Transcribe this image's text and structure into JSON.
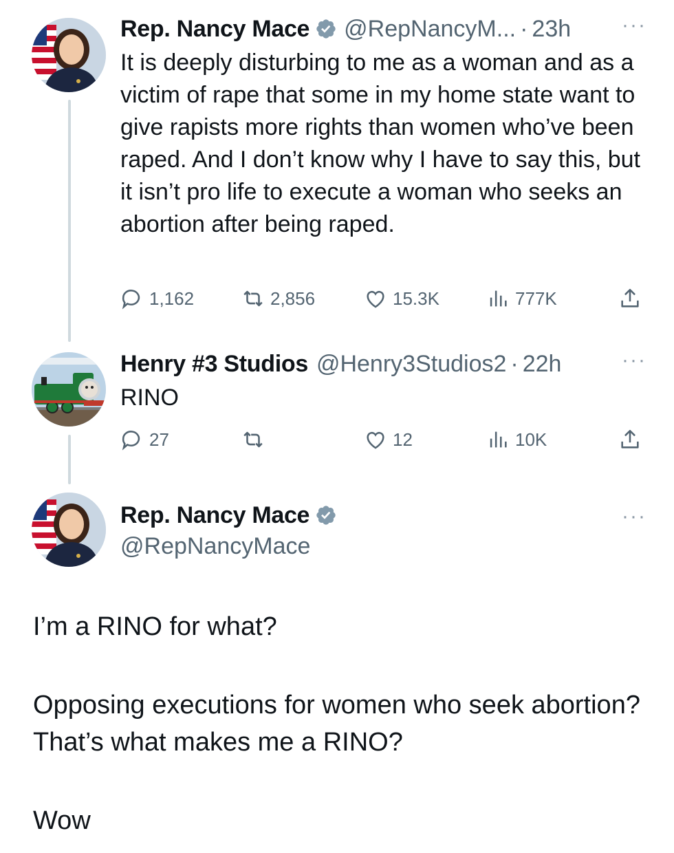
{
  "tweets": [
    {
      "name": "Rep. Nancy Mace",
      "handle": "@RepNancyM...",
      "time": "23h",
      "separator": "·",
      "text": "It is deeply disturbing to me as a woman and as a victim of rape that some in my home state want to give rapists more rights than women who’ve been raped. And I don’t know why I have to say this, but it isn’t pro life to execute a woman who seeks an abortion after being raped.",
      "replies": "1,162",
      "retweets": "2,856",
      "likes": "15.3K",
      "views": "777K"
    },
    {
      "name": "Henry #3 Studios",
      "handle": "@Henry3Studios2",
      "time": "22h",
      "separator": "·",
      "text": "RINO",
      "replies": "27",
      "retweets": "",
      "likes": "12",
      "views": "10K"
    }
  ],
  "main_tweet": {
    "name": "Rep. Nancy Mace",
    "handle": "@RepNancyMace",
    "paragraphs": [
      "I’m a RINO for what?",
      "Opposing executions for women who seek abortion? That’s what makes me a RINO?",
      "Wow"
    ]
  },
  "more_label": "···",
  "colors": {
    "text": "#0f1419",
    "secondary": "#536471",
    "verified": "#829aab",
    "thread_line": "#cfd9de"
  },
  "icons": [
    "reply-icon",
    "retweet-icon",
    "like-icon",
    "views-icon",
    "share-icon",
    "verified-badge-icon",
    "more-icon"
  ]
}
